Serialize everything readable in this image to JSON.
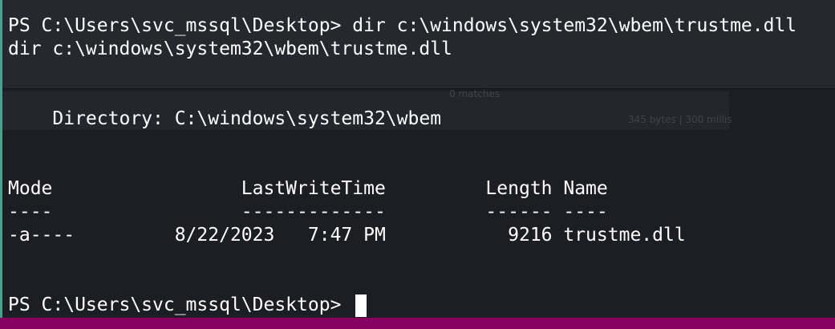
{
  "terminal": {
    "lines": [
      "PS C:\\Users\\svc_mssql\\Desktop> dir c:\\windows\\system32\\wbem\\trustme.dll",
      "dir c:\\windows\\system32\\wbem\\trustme.dll",
      "    Directory: C:\\windows\\system32\\wbem",
      "Mode                 LastWriteTime         Length Name",
      "----                 -------------         ------ ----",
      "-a----         8/22/2023   7:47 PM           9216 trustme.dll",
      "PS C:\\Users\\svc_mssql\\Desktop> "
    ],
    "ghost": {
      "matches": "0 matches",
      "stats": "345 bytes | 300 millis"
    }
  },
  "colors": {
    "background": "#1c1e24",
    "text": "#ffffff",
    "accent_edge": "#3fa58c",
    "status_bar": "#850061"
  }
}
